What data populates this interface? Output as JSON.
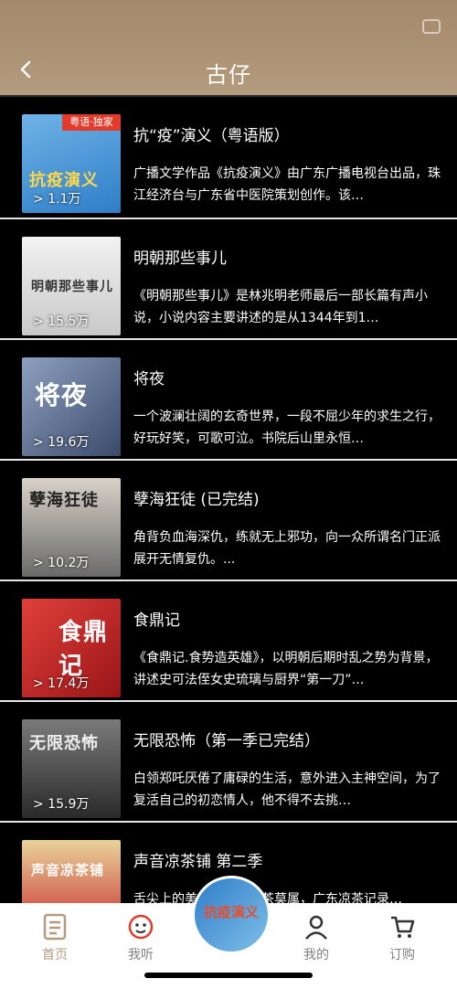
{
  "header": {
    "title": "古仔"
  },
  "items": [
    {
      "title": "抗“疫”演义（粤语版）",
      "desc": "广播文学作品《抗疫演义》由广东广播电视台出品，珠江经济台与广东省中医院策划创作。该…",
      "count": "> 1.1万",
      "cover_text": "抗疫演义",
      "cover_badge": "粤语·独家",
      "cover_bg": "#2f7ec9"
    },
    {
      "title": "明朝那些事儿",
      "desc": "《明朝那些事儿》是林兆明老师最后一部长篇有声小说，小说内容主要讲述的是从1344年到1…",
      "count": "> 15.5万",
      "cover_text": "明朝那些事儿",
      "cover_bg": "#d9d9d9"
    },
    {
      "title": "将夜",
      "desc": "一个波澜壮阔的玄奇世界，一段不屈少年的求生之行，好玩好笑，可歌可泣。书院后山里永恒…",
      "count": "> 19.6万",
      "cover_text": "将夜",
      "cover_bg": "#5a6d8f"
    },
    {
      "title": "孽海狂徒 (已完结)",
      "desc": "角背负血海深仇，练就无上邪功，向一众所谓名门正派展开无情复仇。...",
      "count": "> 10.2万",
      "cover_text": "孽海狂徒",
      "cover_bg": "#8b8b8b"
    },
    {
      "title": "食鼎记",
      "desc": "《食鼎记.食势造英雄》，以明朝后期时乱之势为背景，讲述史可法侄女史琉璃与厨界“第一刀”…",
      "count": "> 17.4万",
      "cover_text": "食鼎记",
      "cover_bg": "#c8272b"
    },
    {
      "title": "无限恐怖（第一季已完结）",
      "desc": "白领郑吒厌倦了庸碌的生活，意外进入主神空间，为了复活自己的初恋情人，他不得不去挑…",
      "count": "> 15.9万",
      "cover_text": "无限恐怖",
      "cover_bg": "#4a4a4a"
    },
    {
      "title": "声音凉茶铺 第二季",
      "desc": "舌尖上的美味，广东凉茶莫属，广东凉茶记录…",
      "count": "",
      "cover_text": "声音凉茶铺",
      "cover_bg": "#c8272b"
    }
  ],
  "nav": {
    "home": "首页",
    "listen": "我听",
    "mine": "我的",
    "subscribe": "订购",
    "center_text": "抗疫演义"
  },
  "colors": {
    "header": "#b39b7d",
    "active": "#b39b7d",
    "inactive": "#808080"
  }
}
